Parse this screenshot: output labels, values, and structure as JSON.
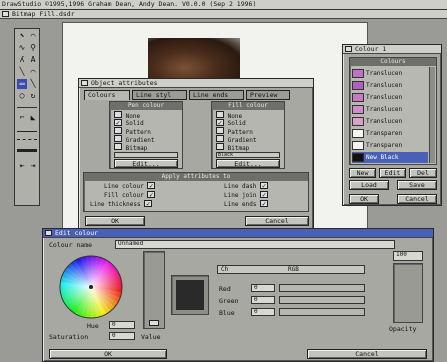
{
  "screen": {
    "title": "DrawStudio ©1995,1996 Graham Dean, Andy Dean. V0.0.0 (Sep 2 1996)",
    "menu": "Bitmap Fill.dsdr"
  },
  "tools": [
    "⬉",
    "⌒",
    "◌",
    "🔍",
    "A",
    "A",
    "╲",
    "⌒",
    "▭",
    "╲",
    "◯",
    "◌"
  ],
  "object_attributes": {
    "title": "Object attributes",
    "tabs": [
      "Colours",
      "Line styl",
      "Line ends",
      "Preview"
    ],
    "pen_colour": {
      "header": "Pen colour",
      "options": [
        "None",
        "Solid",
        "Pattern",
        "Gradient",
        "Bitmap"
      ],
      "edit_label": "Edit..."
    },
    "fill_colour": {
      "header": "Fill colour",
      "options": [
        "None",
        "Solid",
        "Pattern",
        "Gradient",
        "Bitmap"
      ],
      "swatch_label": "Black",
      "edit_label": "Edit..."
    },
    "apply_header": "Apply attributes to",
    "apply_left": [
      "Line colour",
      "Fill colour",
      "Line thickness"
    ],
    "apply_right": [
      "Line dash",
      "Line join",
      "Line ends"
    ],
    "ok_label": "OK",
    "cancel_label": "Cancel"
  },
  "colour_window": {
    "title": "Colour 1",
    "header": "Colours",
    "items": [
      {
        "label": "Translucen",
        "swatch": "#c070c8"
      },
      {
        "label": "Translucen",
        "swatch": "#b060c0"
      },
      {
        "label": "Translucen",
        "swatch": "#c878c0"
      },
      {
        "label": "Translucen",
        "swatch": "#d08cc8"
      },
      {
        "label": "Translucen",
        "swatch": "#d8a0cc"
      },
      {
        "label": "Transparen",
        "swatch": "#f4f4f0"
      },
      {
        "label": "Transparen",
        "swatch": "#f4f4f0"
      },
      {
        "label": "New Black",
        "swatch": "#111111"
      }
    ],
    "buttons": [
      "New",
      "Edit",
      "Del",
      "Load",
      "Save"
    ],
    "ok_label": "OK",
    "cancel_label": "Cancel"
  },
  "edit_colour": {
    "title": "Edit colour",
    "name_label": "Colour name",
    "name_value": "Unnamed",
    "mode_label": "RGB",
    "mode_left": "Ch",
    "hue_label": "Hue",
    "hue_value": "0",
    "saturation_label": "Saturation",
    "saturation_value": "0",
    "value_label": "Value",
    "value_value": "0",
    "red_label": "Red",
    "red_value": "0",
    "green_label": "Green",
    "green_value": "0",
    "blue_label": "Blue",
    "blue_value": "0",
    "opacity_label": "Opacity",
    "opacity_value": "100",
    "ok_label": "OK",
    "cancel_label": "Cancel"
  }
}
